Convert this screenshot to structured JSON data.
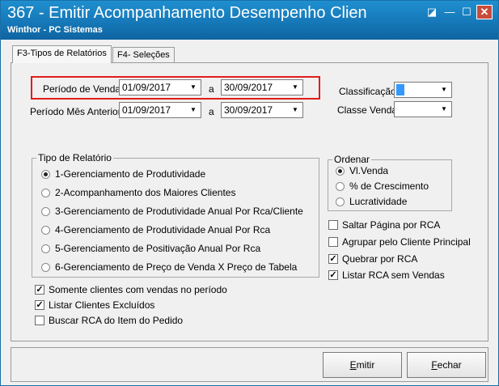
{
  "window": {
    "title": "367 - Emitir Acompanhamento Desempenho Clien",
    "subtitle": "Winthor - PC Sistemas",
    "close_glyph": "✕",
    "minimize_glyph": "—",
    "maximize_glyph": "☐",
    "help_glyph": "◪"
  },
  "tabs": [
    {
      "label": "F3-Tipos de Relatórios",
      "active": true
    },
    {
      "label": "F4- Seleções",
      "active": false
    }
  ],
  "periodo_venda": {
    "label": "Período de Venda:",
    "from": "01/09/2017",
    "sep": "a",
    "to": "30/09/2017"
  },
  "periodo_mes_anterior": {
    "label": "Período Mês Anterior:",
    "from": "01/09/2017",
    "sep": "a",
    "to": "30/09/2017"
  },
  "classificacao": {
    "label": "Classificação:",
    "value": ""
  },
  "classe_venda": {
    "label": "Classe Venda:",
    "value": ""
  },
  "tipo_relatorio": {
    "title": "Tipo de Relatório",
    "options": [
      {
        "label": "1-Gerenciamento de Produtividade",
        "selected": true
      },
      {
        "label": "2-Acompanhamento dos Maiores Clientes",
        "selected": false
      },
      {
        "label": "3-Gerenciamento de Produtividade Anual Por Rca/Cliente",
        "selected": false
      },
      {
        "label": "4-Gerenciamento de Produtividade Anual Por Rca",
        "selected": false
      },
      {
        "label": "5-Gerenciamento de Positivação Anual Por Rca",
        "selected": false
      },
      {
        "label": "6-Gerenciamento de Preço de Venda X Preço de Tabela",
        "selected": false
      }
    ]
  },
  "ordenar": {
    "title": "Ordenar",
    "options": [
      {
        "label": "Vl.Venda",
        "selected": true
      },
      {
        "label": "% de Crescimento",
        "selected": false
      },
      {
        "label": "Lucratividade",
        "selected": false
      }
    ]
  },
  "right_checks": [
    {
      "label": "Saltar Página por RCA",
      "checked": false
    },
    {
      "label": "Agrupar pelo Cliente Principal",
      "checked": false
    },
    {
      "label": "Quebrar por RCA",
      "checked": true
    },
    {
      "label": "Listar RCA sem Vendas",
      "checked": true
    }
  ],
  "left_checks": [
    {
      "label": "Somente clientes com vendas no período",
      "checked": true
    },
    {
      "label": "Listar Clientes Excluídos",
      "checked": true
    },
    {
      "label": "Buscar RCA do Item do Pedido",
      "checked": false
    }
  ],
  "buttons": {
    "emitir_first": "E",
    "emitir_rest": "mitir",
    "fechar_first": "F",
    "fechar_rest": "echar"
  },
  "check_glyph": "✓",
  "dropdown_glyph": "▼"
}
